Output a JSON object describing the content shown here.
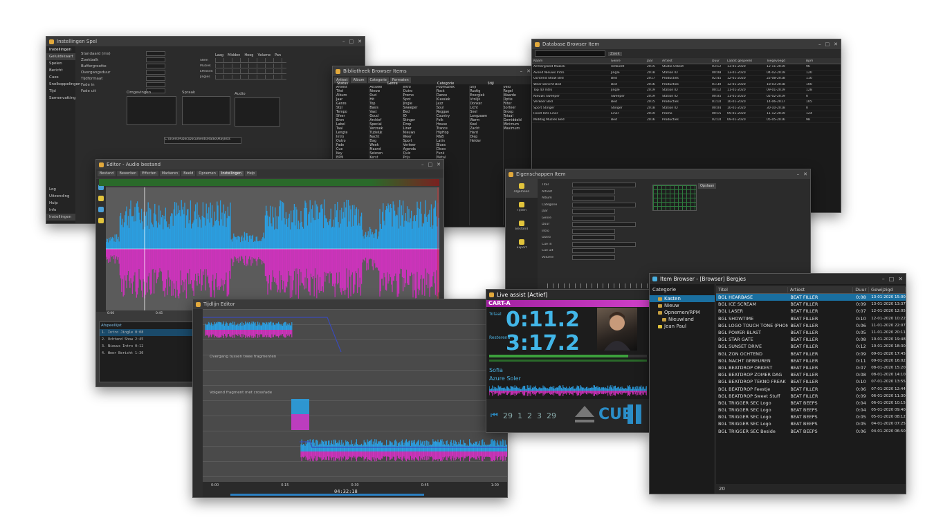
{
  "win_settings": {
    "title": "Instellingen Spel",
    "sidebar_header": "Instellingen",
    "sidebar": [
      "Geluidskaart",
      "Spelen",
      "Bericht",
      "Cues",
      "Snelkoppelingen",
      "Tijd",
      "Samenvatting"
    ],
    "bottom_items": [
      "Log",
      "Uitzending",
      "Hulp",
      "Info",
      "Instellingen"
    ],
    "lines": [
      "Standaard (ms)",
      "Zoekbalk",
      "Buffergrootte",
      "Overgangsduur",
      "Tijdformaat",
      "Fade in",
      "Fade uit"
    ],
    "table_headers": [
      "Laag",
      "Midden",
      "Hoog",
      "Volume",
      "Pan"
    ],
    "table_rows": [
      "Stem",
      "Muziek",
      "Effecten",
      "Jingles"
    ],
    "lbl_a": "Omgevingen",
    "lbl_b": "Spraak",
    "lbl_c": "Audio",
    "path_value": "C:\\Users\\Public\\Documents\\Radio\\Playlists"
  },
  "win_lists": {
    "title": "Bibliotheek Browser Items",
    "toolbar": [
      "Artiest",
      "Album",
      "Categorie",
      "Formaten"
    ],
    "columns": [
      "Status",
      "Genre",
      "Categorie",
      "Stijl"
    ],
    "cells": [
      "Artiest\nTitel\nAlbum\nJaar\nGenre\nStijl\nTempo\nSfeer\nBron\nLabel\nTaal\nLengte\nIntro\nOutro\nFade\nCue\nKey\nBPM\nLuid\nGain\nTag\nNota",
      "Actueel\nNieuw\nOud\nHit\nTop\nBasis\nVast\nGoud\nArchief\nSpecial\nVerzoek\nTijdelijk\nNacht\nDag\nWeek\nMaand\nSeizoen\nKerst\nZomer\nFeest\nLive",
      "Intro\nOutro\nPromo\nSpot\nJingle\nSweeper\nBed\nID\nStinger\nDrop\nLiner\nNieuws\nWeer\nSport\nVerkeer\nAgenda\nQuiz\nPrijs",
      "Popmuziek\nRock\nDance\nKlassiek\nJazz\nSoul\nReggae\nCountry\nFolk\nHouse\nTrance\nHipHop\nR&B\nLatin\nBlues\nDisco\nFunk\nMetal",
      "Stijl\nRustig\nEnergiek\nVrolijk\nDonker\nLicht\nSnel\nLangzaam\nWarm\nKoel\nZacht\nHard\nDiep\nHelder",
      "Veld\nRegel\nWaarde\nOptie\nFilter\nSorteer\nGroep\nTotaal\nGemiddeld\nMinimum\nMaximum"
    ]
  },
  "win_db": {
    "title": "Database Browser Item",
    "search_btn": "Zoek",
    "columns": [
      "Naam",
      "Genre",
      "Jaar",
      "Artiest",
      "Duur",
      "Laatst gespeeld",
      "Toegevoegd",
      "Bpm"
    ],
    "rows": [
      [
        "Achtergrond Muziek",
        "Ambient",
        "2015",
        "Studio Orkest",
        "03:12",
        "13-01-2020",
        "12-11-2019",
        "96"
      ],
      [
        "Avond Nieuws Intro",
        "Jingle",
        "2018",
        "Station ID",
        "00:08",
        "13-01-2020",
        "04-02-2019",
        "120"
      ],
      [
        "Ochtend Show Bed",
        "Bed",
        "2017",
        "Producties",
        "02:45",
        "12-01-2020",
        "22-08-2018",
        "110"
      ],
      [
        "Weer Bericht Bed",
        "Bed",
        "2016",
        "Producties",
        "01:30",
        "12-01-2020",
        "18-03-2018",
        "100"
      ],
      [
        "Top 40 Intro",
        "Jingle",
        "2019",
        "Station ID",
        "00:12",
        "11-01-2020",
        "09-01-2019",
        "128"
      ],
      [
        "Nieuws Sweeper",
        "Sweeper",
        "2019",
        "Station ID",
        "00:05",
        "11-01-2020",
        "02-02-2019",
        "0"
      ],
      [
        "Verkeer Bed",
        "Bed",
        "2015",
        "Producties",
        "01:10",
        "10-01-2020",
        "14-06-2017",
        "105"
      ],
      [
        "Sport Stinger",
        "Stinger",
        "2018",
        "Station ID",
        "00:04",
        "10-01-2020",
        "30-10-2018",
        "0"
      ],
      [
        "Feest Hits Liner",
        "Liner",
        "2019",
        "Promo",
        "00:15",
        "09-01-2020",
        "11-12-2019",
        "124"
      ],
      [
        "Middag Muziek Bed",
        "Bed",
        "2016",
        "Producties",
        "02:10",
        "09-01-2020",
        "05-05-2016",
        "98"
      ]
    ]
  },
  "win_wave": {
    "title": "Editor - Audio bestand",
    "tabs": [
      "Bestand",
      "Bewerken",
      "Effecten",
      "Markeren",
      "Beeld",
      "Opnemen",
      "Instellingen",
      "Help"
    ],
    "times": [
      "0:00",
      "0:45",
      "1:30",
      "2:15",
      "3:00",
      "3:45",
      "4:30"
    ],
    "mini_label": "Afspeellijst",
    "mini_rows": [
      "1.  Intro Jingle       0:08",
      "2.  Ochtend Show     2:45",
      "3.  Nieuws Intro       0:12",
      "4.  Weer Bericht       1:30"
    ]
  },
  "win_pl": {
    "title": "Eigenschappen Item",
    "tabs": [
      "Algemeen",
      "Tijden",
      "Bestand",
      "Export"
    ],
    "fields": [
      "Titel",
      "Artiest",
      "Album",
      "Categorie",
      "Jaar",
      "Genre",
      "Duur",
      "Intro",
      "Outro",
      "Cue in",
      "Cue uit",
      "Volume"
    ],
    "sched_btn": "Opslaan"
  },
  "win_edit": {
    "title": "Tijdlijn Editor",
    "clip1": "Overgang tussen twee fragmenten",
    "clip2": "Volgend fragment met crossfade",
    "foot": [
      "0:00",
      "0:15",
      "0:30",
      "0:45",
      "1:00"
    ],
    "time_display": "04:32:18"
  },
  "win_live": {
    "title": "Live assist [Actief]",
    "cart": "CART-A",
    "label_tot": "Totaal",
    "label_rem": "Resterend",
    "elapsed": "0:11.2",
    "remaining": "3:17.2",
    "artist": "Sofia",
    "track": "Azure Soler",
    "nums": [
      "29",
      "1",
      "2",
      "3",
      "29"
    ],
    "cue_label": "CUE"
  },
  "win_browser": {
    "title": "Item Browser - [Browser] Bergjes",
    "tree_header": "Categorie",
    "tree": [
      {
        "label": "Kasten",
        "indent": 1,
        "sel": true
      },
      {
        "label": "Nieuw",
        "indent": 1,
        "sel": false
      },
      {
        "label": "Opnemen/RPM",
        "indent": 1,
        "sel": false
      },
      {
        "label": "Nieuwland",
        "indent": 2,
        "sel": false
      },
      {
        "label": "Jean Paul",
        "indent": 1,
        "sel": false
      }
    ],
    "columns": [
      "Titel",
      "Artiest",
      "Duur",
      "Gewijzigd"
    ],
    "rows": [
      [
        "BGL HEARBASE",
        "BEAT FILLER",
        "0:08",
        "13-01-2020 15:00"
      ],
      [
        "BGL ICE SCREAM",
        "BEAT FILLER",
        "0:09",
        "13-01-2020 13:37"
      ],
      [
        "BGL LASER",
        "BEAT FILLER",
        "0:07",
        "12-01-2020 12:05"
      ],
      [
        "BGL SHOWTIME",
        "BEAT FILLER",
        "0:10",
        "12-01-2020 10:22"
      ],
      [
        "BGL LOGO TOUCH TONE (PHONES)",
        "BEAT FILLER",
        "0:06",
        "11-01-2020 22:07"
      ],
      [
        "BGL POWER BLAST",
        "BEAT FILLER",
        "0:05",
        "11-01-2020 20:11"
      ],
      [
        "BGL STAR GATE",
        "BEAT FILLER",
        "0:08",
        "10-01-2020 19:48"
      ],
      [
        "BGL SUNSET DRIVE",
        "BEAT FILLER",
        "0:12",
        "10-01-2020 18:30"
      ],
      [
        "BGL ZON OCHTEND",
        "BEAT FILLER",
        "0:09",
        "09-01-2020 17:45"
      ],
      [
        "BGL NACHT GEBEUREN",
        "BEAT FILLER",
        "0:11",
        "09-01-2020 16:02"
      ],
      [
        "BGL BEATDROP ORKEST",
        "BEAT FILLER",
        "0:07",
        "08-01-2020 15:20"
      ],
      [
        "BGL BEATDROP ZOMER DAG",
        "BEAT FILLER",
        "0:08",
        "08-01-2020 14:10"
      ],
      [
        "BGL BEATDROP TEKNO FREAK",
        "BEAT FILLER",
        "0:10",
        "07-01-2020 13:55"
      ],
      [
        "BGL BEATDROP Feestje",
        "BEAT FILLER",
        "0:06",
        "07-01-2020 12:44"
      ],
      [
        "BGL BEATDROP Sweet Stuff",
        "BEAT FILLER",
        "0:09",
        "06-01-2020 11:30"
      ],
      [
        "BGL TRIGGER SEC Logo",
        "BEAT BEEPS",
        "0:04",
        "06-01-2020 10:15"
      ],
      [
        "BGL TRIGGER SEC Logo",
        "BEAT BEEPS",
        "0:04",
        "05-01-2020 09:40"
      ],
      [
        "BGL TRIGGER SEC Logo",
        "BEAT BEEPS",
        "0:05",
        "05-01-2020 08:12"
      ],
      [
        "BGL TRIGGER SEC Logo",
        "BEAT BEEPS",
        "0:05",
        "04-01-2020 07:25"
      ],
      [
        "BGL TRIGGER SEC Beside",
        "BEAT BEEPS",
        "0:06",
        "04-01-2020 06:50"
      ]
    ],
    "footer": "20"
  }
}
